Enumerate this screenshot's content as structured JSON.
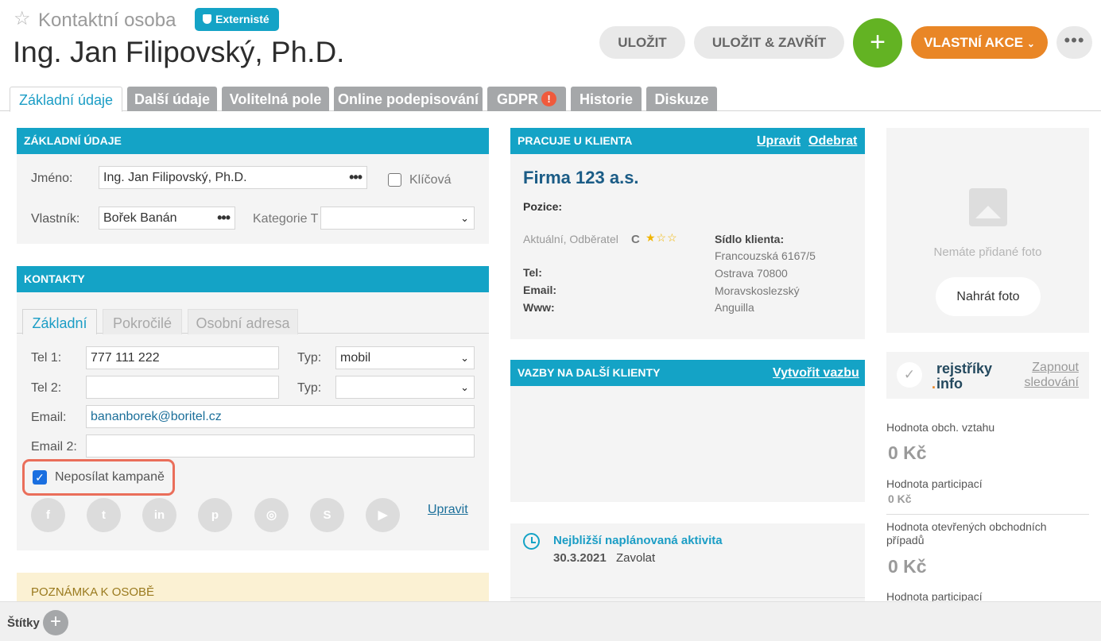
{
  "header": {
    "subtitle": "Kontaktní osoba",
    "badge": "Externisté",
    "title": "Ing. Jan Filipovský, Ph.D.",
    "save_label": "ULOŽIT",
    "save_close_label": "ULOŽIT & ZAVŘÍT",
    "plus_label": "+",
    "custom_actions_label": "VLASTNÍ AKCE",
    "more_label": "•••"
  },
  "tabs": [
    {
      "label": "Základní údaje"
    },
    {
      "label": "Další údaje"
    },
    {
      "label": "Volitelná pole"
    },
    {
      "label": "Online podepisování"
    },
    {
      "label": "GDPR",
      "alert": "!"
    },
    {
      "label": "Historie"
    },
    {
      "label": "Diskuze"
    }
  ],
  "basic": {
    "heading": "ZÁKLADNÍ ÚDAJE",
    "name_label": "Jméno:",
    "name_value": "Ing. Jan Filipovský, Ph.D.",
    "key_label": "Klíčová",
    "key_checked": false,
    "owner_label": "Vlastník:",
    "owner_value": "Bořek Banán",
    "category_label": "Kategorie T",
    "category_value": "",
    "dots": "•••"
  },
  "contacts": {
    "heading": "KONTAKTY",
    "subtabs": [
      {
        "label": "Základní"
      },
      {
        "label": "Pokročilé"
      },
      {
        "label": "Osobní adresa"
      }
    ],
    "tel1_label": "Tel 1:",
    "tel1_value": "777 111 222",
    "type_label": "Typ:",
    "type1_value": "mobil",
    "tel2_label": "Tel 2:",
    "tel2_value": "",
    "type2_value": "",
    "email_label": "Email:",
    "email_value": "bananborek@boritel.cz",
    "email2_label": "Email 2:",
    "email2_value": "",
    "no_campaigns_label": "Neposílat kampaně",
    "no_campaigns_checked": true,
    "social": [
      {
        "icon": "facebook-icon",
        "glyph": "f"
      },
      {
        "icon": "twitter-icon",
        "glyph": "t"
      },
      {
        "icon": "linkedin-icon",
        "glyph": "in"
      },
      {
        "icon": "pinterest-icon",
        "glyph": "p"
      },
      {
        "icon": "instagram-icon",
        "glyph": "◎"
      },
      {
        "icon": "skype-icon",
        "glyph": "S"
      },
      {
        "icon": "youtube-icon",
        "glyph": "▶"
      }
    ],
    "edit_link": "Upravit"
  },
  "note": {
    "heading": "POZNÁMKA K OSOBĚ"
  },
  "client": {
    "heading": "PRACUJE U KLIENTA",
    "edit_link": "Upravit",
    "remove_link": "Odebrat",
    "company": "Firma 123 a.s.",
    "position_label": "Pozice:",
    "status": "Aktuální, Odběratel",
    "grade": "C",
    "stars_filled": 1,
    "stars_total": 3,
    "tel_label": "Tel:",
    "email_label": "Email:",
    "www_label": "Www:",
    "seat_label": "Sídlo klienta:",
    "address": [
      "Francouzská 6167/5",
      "Ostrava 70800",
      "Moravskoslezský",
      "Anguilla"
    ]
  },
  "relations": {
    "heading": "VAZBY NA DALŠÍ KLIENTY",
    "create_link": "Vytvořit vazbu"
  },
  "activity": {
    "title": "Nejbližší naplánovaná aktivita",
    "date": "30.3.2021",
    "text": "Zavolat"
  },
  "photo": {
    "empty_text": "Nemáte přidané foto",
    "upload_label": "Nahrát foto"
  },
  "registry": {
    "logo_line1": "rejstříky",
    "logo_dot": ".",
    "logo_line2": "info",
    "link_line1": "Zapnout",
    "link_line2": "sledování"
  },
  "stats": [
    {
      "label": "Hodnota obch. vztahu",
      "value": "0 Kč"
    },
    {
      "label": "Hodnota participací",
      "value": "0 Kč"
    },
    {
      "label": "Hodnota otevřených obchodních",
      "label2": "případů",
      "value": "0 Kč"
    },
    {
      "label": "Hodnota participací"
    }
  ],
  "footer": {
    "tags_label": "Štítky",
    "add_label": "+"
  },
  "colors": {
    "accent": "#14a3c6",
    "green": "#63b323",
    "orange": "#e98626",
    "alert": "#f05a3c"
  }
}
